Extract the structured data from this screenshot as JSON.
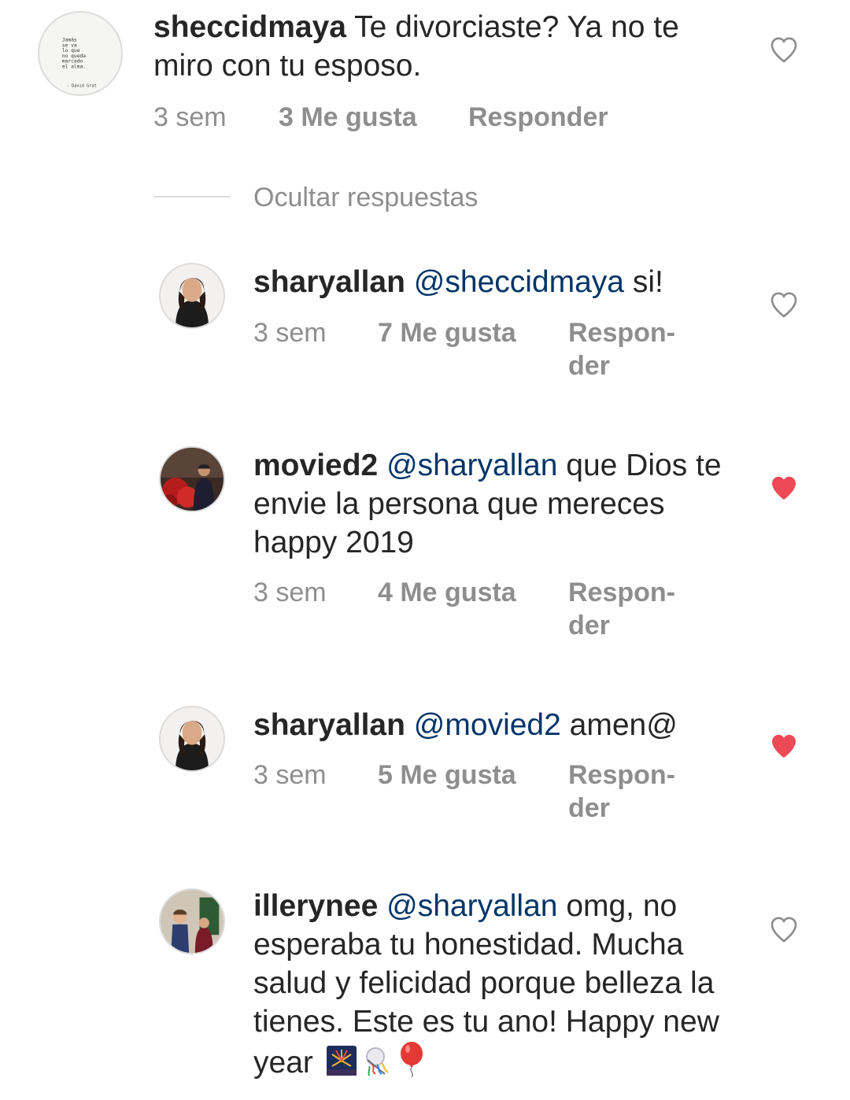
{
  "comments": [
    {
      "username": "sheccidmaya",
      "text": " Te divorciaste? Ya no te miro con tu esposo.",
      "time": "3 sem",
      "likes": "3 Me gusta",
      "reply": "Responder",
      "liked": false
    }
  ],
  "hide_replies_label": "Ocultar respuestas",
  "replies": [
    {
      "username": "sharyallan",
      "mention": "@sheccidmaya",
      "text": " si!",
      "time": "3 sem",
      "likes": "7 Me gusta",
      "reply": "Respon-der",
      "liked": false
    },
    {
      "username": "movied2",
      "mention": "@sharyallan",
      "text": " que Dios te envie la persona que mereces happy 2019",
      "time": "3 sem",
      "likes": "4 Me gusta",
      "reply": "Respon-der",
      "liked": true
    },
    {
      "username": "sharyallan",
      "mention": "@movied2",
      "text": " amen@",
      "time": "3 sem",
      "likes": "5 Me gusta",
      "reply": "Respon-der",
      "liked": true
    },
    {
      "username": "illerynee",
      "mention": "@sharyallan",
      "text": " omg, no esperaba tu honestidad. Mucha salud y felicidad porque belleza la tienes. Este es tu ano! Happy new year ",
      "liked": false
    }
  ],
  "avatar_quote_lines": [
    "Jamás",
    "se va",
    "lo que",
    "no queda",
    "marcado",
    "el alma.",
    "- David Grat"
  ],
  "colors": {
    "text": "#262626",
    "mention": "#003569",
    "meta": "#8e8e8e",
    "heart_liked": "#ed4956",
    "heart_outline": "#8e8e8e"
  },
  "icons": {
    "like": "heart-icon",
    "emoji": [
      "fireworks-emoji",
      "confetti-emoji",
      "balloon-emoji"
    ]
  }
}
